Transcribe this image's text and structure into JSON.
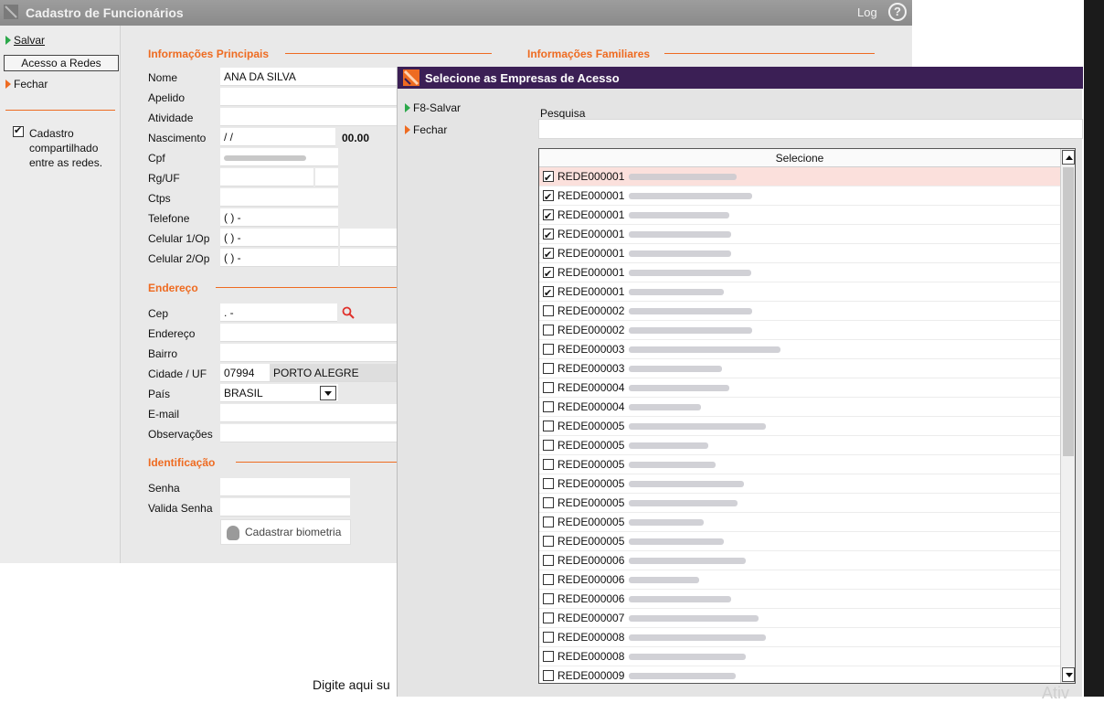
{
  "main": {
    "title": "Cadastro de Funcionários",
    "log_label": "Log",
    "help": "?",
    "sidebar": {
      "save": "Salvar",
      "networks": "Acesso a Redes",
      "close": "Fechar",
      "shared_label": "Cadastro compartilhado entre as redes.",
      "shared_checked": true
    },
    "sections": {
      "main_info": "Informações Principais",
      "family_info": "Informações Familiares",
      "address": "Endereço",
      "identification": "Identificação"
    },
    "fields": {
      "nome": {
        "label": "Nome",
        "value": "ANA DA SILVA"
      },
      "apelido": {
        "label": "Apelido",
        "value": ""
      },
      "atividade": {
        "label": "Atividade",
        "value": ""
      },
      "nascimento": {
        "label": "Nascimento",
        "value": " / /",
        "extra": "00.00"
      },
      "cpf": {
        "label": "Cpf"
      },
      "rg": {
        "label": "Rg/UF"
      },
      "ctps": {
        "label": "Ctps"
      },
      "telefone": {
        "label": "Telefone",
        "value": "( )  -"
      },
      "celular1": {
        "label": "Celular 1/Op",
        "value": "( )  -"
      },
      "celular2": {
        "label": "Celular 2/Op",
        "value": "( )  -"
      },
      "cep": {
        "label": "Cep",
        "value": " .  -"
      },
      "endereco": {
        "label": "Endereço"
      },
      "bairro": {
        "label": "Bairro"
      },
      "cidade": {
        "label": "Cidade / UF",
        "code": "07994",
        "value": "PORTO ALEGRE"
      },
      "pais": {
        "label": "País",
        "value": "BRASIL"
      },
      "email": {
        "label": "E-mail"
      },
      "observacoes": {
        "label": "Observações"
      },
      "senha": {
        "label": "Senha"
      },
      "valida_senha": {
        "label": "Valida Senha"
      }
    },
    "biometry_button": "Cadastrar biometria",
    "caption": "Digite aqui su"
  },
  "dialog": {
    "title": "Selecione as Empresas de Acesso",
    "save": "F8-Salvar",
    "close": "Fechar",
    "search_label": "Pesquisa",
    "search_value": "",
    "grid_header": "Selecione",
    "rows": [
      {
        "code": "REDE000001",
        "checked": true
      },
      {
        "code": "REDE000001",
        "checked": true
      },
      {
        "code": "REDE000001",
        "checked": true
      },
      {
        "code": "REDE000001",
        "checked": true
      },
      {
        "code": "REDE000001",
        "checked": true
      },
      {
        "code": "REDE000001",
        "checked": true
      },
      {
        "code": "REDE000001",
        "checked": true
      },
      {
        "code": "REDE000002",
        "checked": false
      },
      {
        "code": "REDE000002",
        "checked": false
      },
      {
        "code": "REDE000003",
        "checked": false
      },
      {
        "code": "REDE000003",
        "checked": false
      },
      {
        "code": "REDE000004",
        "checked": false
      },
      {
        "code": "REDE000004",
        "checked": false
      },
      {
        "code": "REDE000005",
        "checked": false
      },
      {
        "code": "REDE000005",
        "checked": false
      },
      {
        "code": "REDE000005",
        "checked": false
      },
      {
        "code": "REDE000005",
        "checked": false
      },
      {
        "code": "REDE000005",
        "checked": false
      },
      {
        "code": "REDE000005",
        "checked": false
      },
      {
        "code": "REDE000005",
        "checked": false
      },
      {
        "code": "REDE000006",
        "checked": false
      },
      {
        "code": "REDE000006",
        "checked": false
      },
      {
        "code": "REDE000006",
        "checked": false
      },
      {
        "code": "REDE000007",
        "checked": false
      },
      {
        "code": "REDE000008",
        "checked": false
      },
      {
        "code": "REDE000008",
        "checked": false
      },
      {
        "code": "REDE000009",
        "checked": false
      }
    ]
  },
  "background": {
    "activate_text": "Ativ"
  },
  "colors": {
    "accent": "#ee6b21",
    "dialog_title_bg": "#3b1f55",
    "main_title_bg": "#939393",
    "row_highlight": "#fbe0dc"
  }
}
